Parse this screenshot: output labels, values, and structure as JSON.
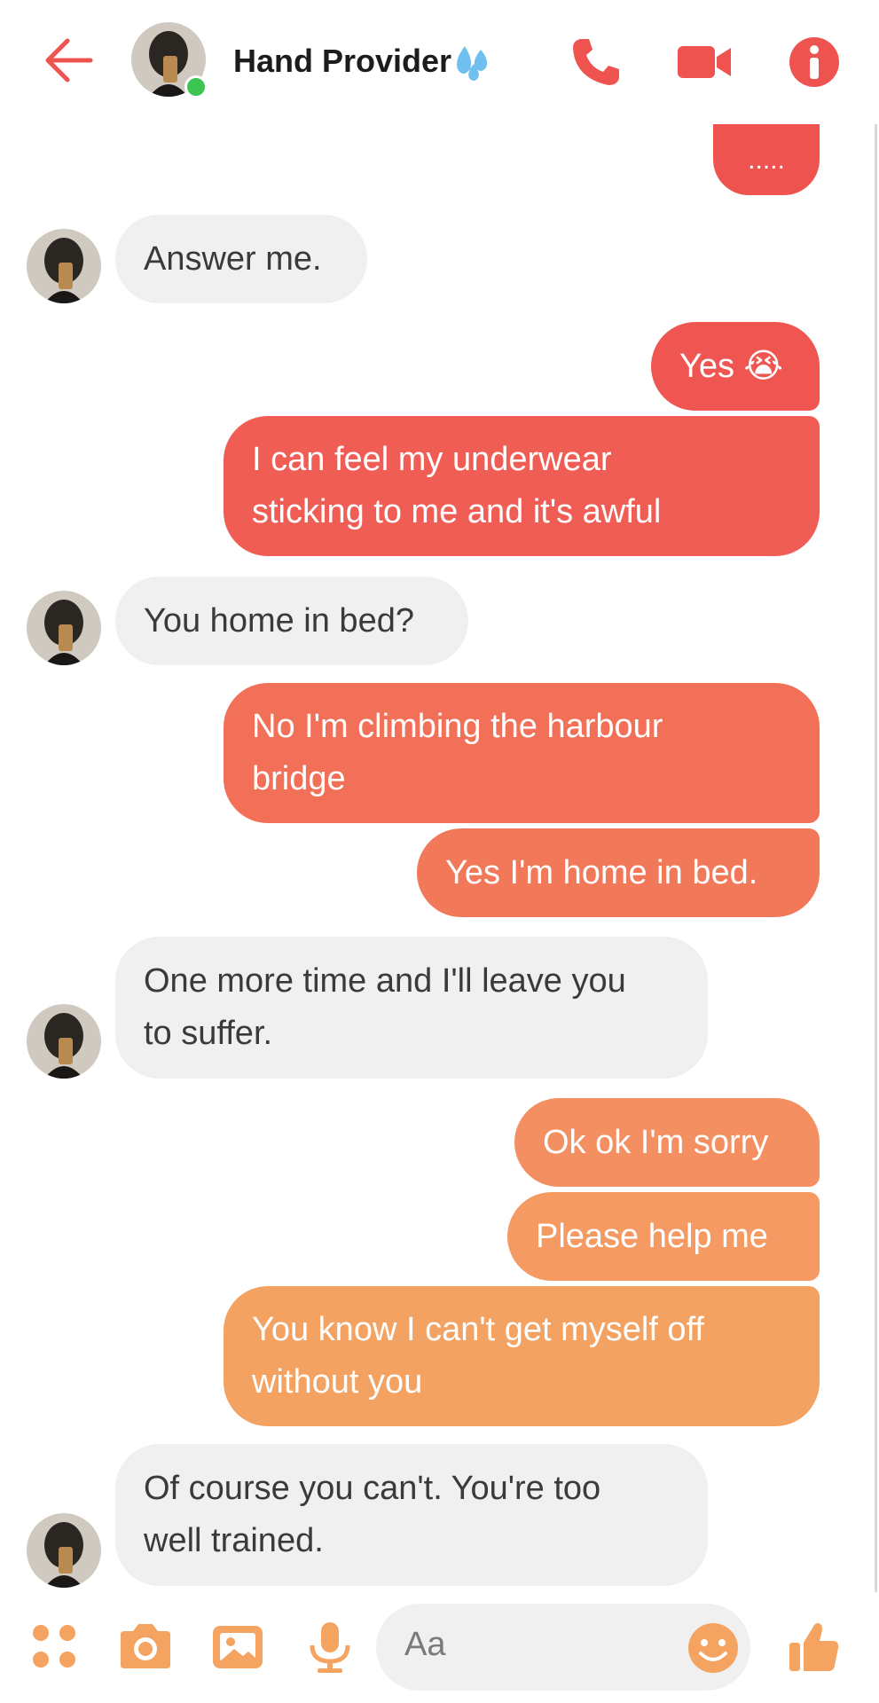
{
  "header": {
    "contact_name": "Hand Provider",
    "icons": [
      "back-arrow-icon",
      "phone-icon",
      "video-camera-icon",
      "info-icon",
      "water-drops-icon"
    ]
  },
  "messages": [
    {
      "side": "out",
      "lines": [
        "....."
      ]
    },
    {
      "side": "in",
      "lines": [
        "Answer me."
      ]
    },
    {
      "side": "out",
      "lines": [
        "Yes 😭"
      ]
    },
    {
      "side": "out",
      "lines": [
        "I can feel my underwear",
        "sticking to me and it's awful"
      ]
    },
    {
      "side": "in",
      "lines": [
        "You home in bed?"
      ]
    },
    {
      "side": "out",
      "lines": [
        "No I'm climbing the harbour",
        "bridge"
      ]
    },
    {
      "side": "out",
      "lines": [
        "Yes I'm home in bed."
      ]
    },
    {
      "side": "in",
      "lines": [
        "One more time and I'll leave you",
        "to suffer."
      ]
    },
    {
      "side": "out",
      "lines": [
        "Ok ok I'm sorry"
      ]
    },
    {
      "side": "out",
      "lines": [
        "Please help me"
      ]
    },
    {
      "side": "out",
      "lines": [
        "You know I can't get myself off",
        "without you"
      ]
    },
    {
      "side": "in",
      "lines": [
        "Of course you can't. You're too",
        "well trained."
      ]
    }
  ],
  "composer": {
    "placeholder": "Aa",
    "icons": [
      "menu-dots-icon",
      "camera-icon",
      "gallery-icon",
      "microphone-icon",
      "emoji-icon",
      "thumbs-up-icon"
    ]
  },
  "colors": {
    "accent_top": "#ef5350",
    "accent_bottom": "#f4a460",
    "incoming_bg": "#f0f0f0",
    "online": "#3cc552"
  }
}
